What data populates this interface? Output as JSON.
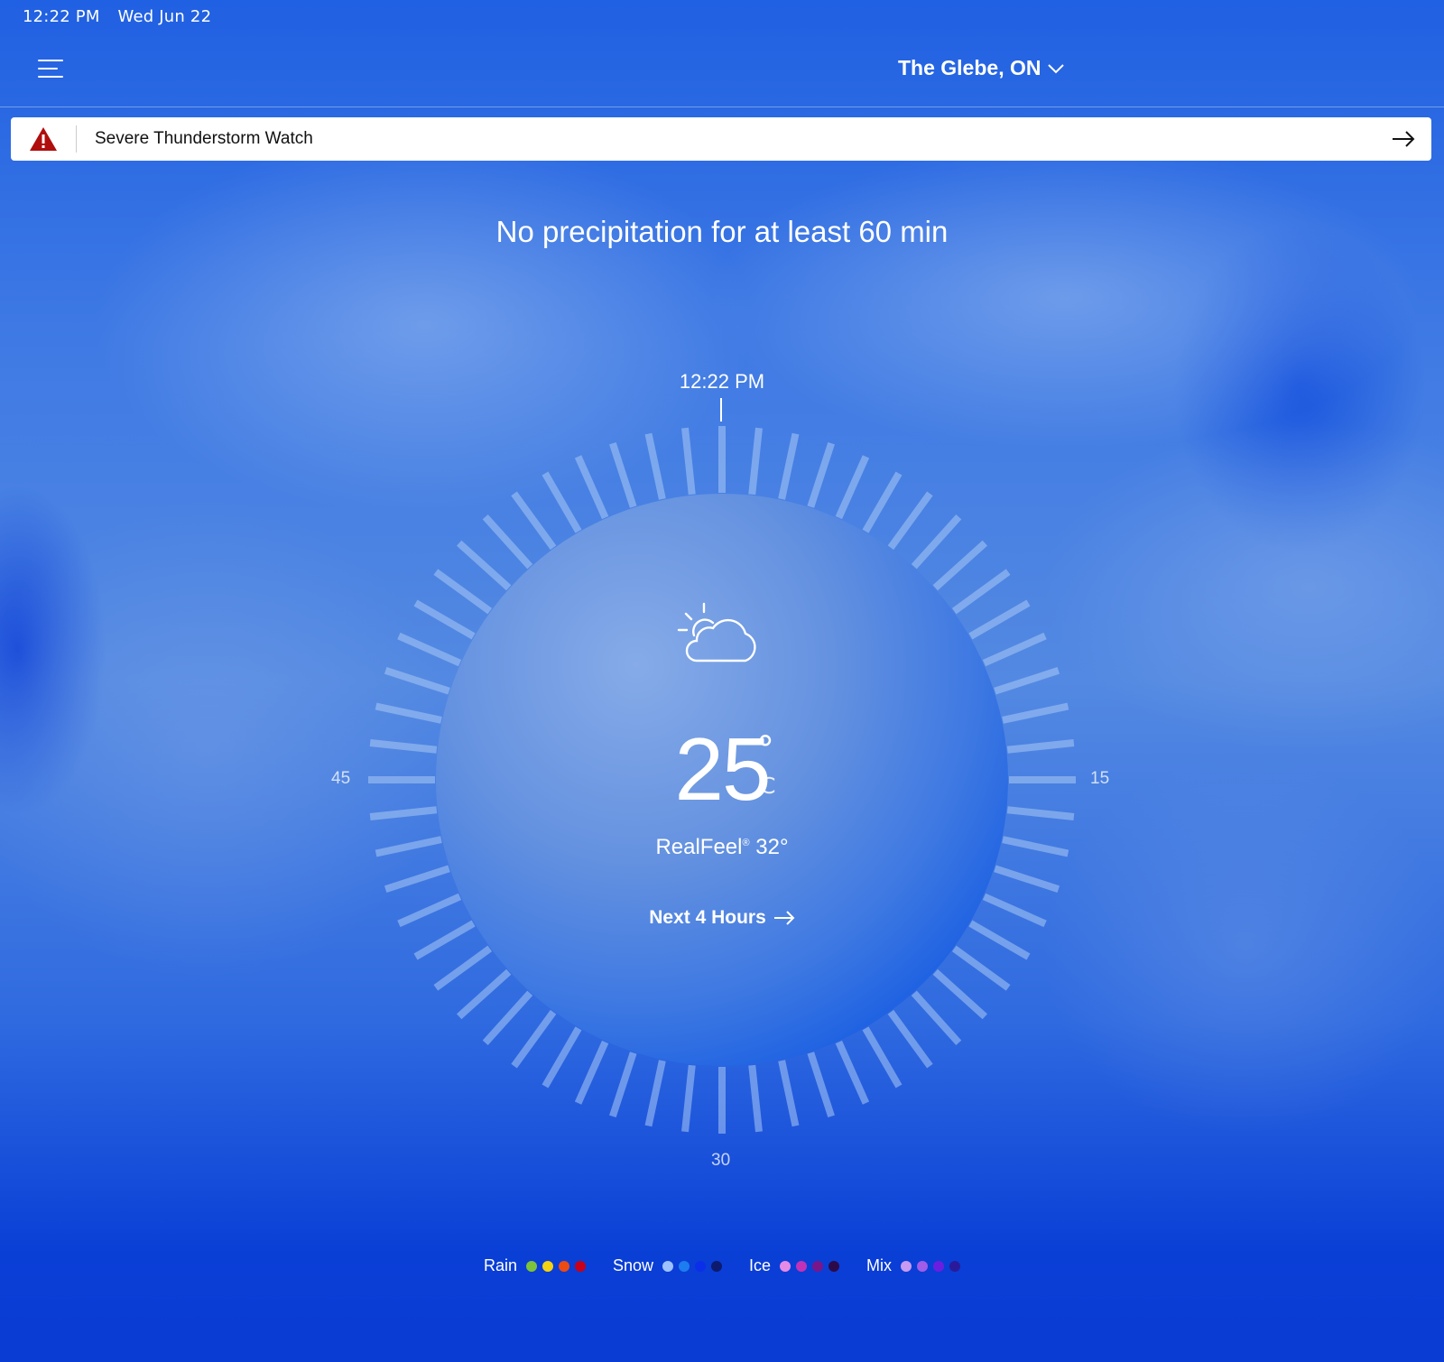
{
  "status_bar": {
    "time": "12:22 PM",
    "date": "Wed Jun 22"
  },
  "header": {
    "menu_icon": "hamburger-menu-icon",
    "location": "The Glebe, ON"
  },
  "alert": {
    "icon": "warning-triangle-icon",
    "text": "Severe Thunderstorm Watch",
    "arrow_icon": "arrow-right-icon",
    "icon_color": "#b00d0d"
  },
  "headline": "No precipitation for at least 60 min",
  "dial": {
    "current_time": "12:22 PM",
    "label_right": "15",
    "label_bottom": "30",
    "label_left": "45"
  },
  "current": {
    "icon": "partly-sunny-icon",
    "temperature": "25",
    "degree_symbol": "°",
    "unit": "C",
    "realfeel_label": "RealFeel",
    "realfeel_mark": "®",
    "realfeel_value": "32°",
    "next_label": "Next 4 Hours"
  },
  "legend": [
    {
      "label": "Rain",
      "colors": [
        "#7ec43b",
        "#f5d312",
        "#ee4b12",
        "#c8001a"
      ]
    },
    {
      "label": "Snow",
      "colors": [
        "#9ec2ff",
        "#1d7cf0",
        "#0b2fe8",
        "#0d1a6e"
      ]
    },
    {
      "label": "Ice",
      "colors": [
        "#e58be6",
        "#c232b7",
        "#7a168a",
        "#2c0a48"
      ]
    },
    {
      "label": "Mix",
      "colors": [
        "#c79bf2",
        "#a15de8",
        "#6c1ee0",
        "#2a1a9a"
      ]
    }
  ]
}
